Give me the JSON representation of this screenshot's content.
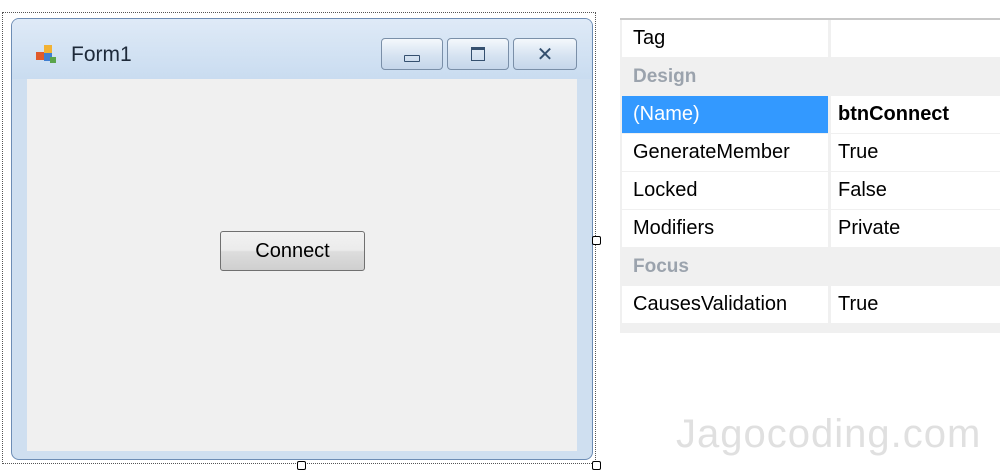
{
  "form": {
    "title": "Form1",
    "icon": "form-icon",
    "caption_buttons": [
      "minimize-icon",
      "maximize-icon",
      "close-icon"
    ],
    "close_glyph": "✕",
    "button_label": "Connect"
  },
  "properties": {
    "rows": [
      {
        "kind": "property",
        "name": "Tag",
        "value": ""
      },
      {
        "kind": "category",
        "name": "Design"
      },
      {
        "kind": "property",
        "name": "(Name)",
        "value": "btnConnect",
        "selected": true
      },
      {
        "kind": "property",
        "name": "GenerateMember",
        "value": "True"
      },
      {
        "kind": "property",
        "name": "Locked",
        "value": "False"
      },
      {
        "kind": "property",
        "name": "Modifiers",
        "value": "Private"
      },
      {
        "kind": "category",
        "name": "Focus"
      },
      {
        "kind": "property",
        "name": "CausesValidation",
        "value": "True"
      }
    ]
  },
  "watermark": "Jagocoding.com",
  "colors": {
    "selection": "#3399ff",
    "category_text": "#9ba3ad",
    "title_bar": "#cfdff0"
  }
}
